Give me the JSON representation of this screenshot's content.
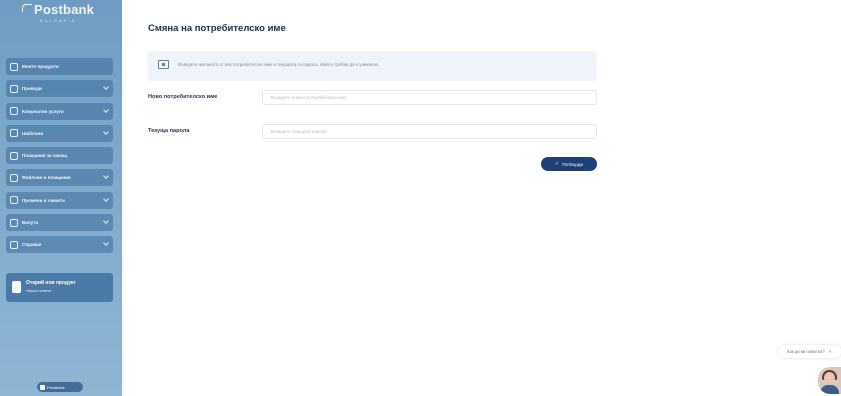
{
  "brand": {
    "name": "Postbank",
    "tagline": "BULGARIA"
  },
  "sidebar": {
    "items": [
      {
        "label": "Моите продукти",
        "icon": "wallet-icon",
        "has_chevron": false
      },
      {
        "label": "Преводи",
        "icon": "transfer-icon",
        "has_chevron": true
      },
      {
        "label": "Комунални услуги",
        "icon": "lightbulb-icon",
        "has_chevron": true
      },
      {
        "label": "Шаблони",
        "icon": "grid-icon",
        "has_chevron": true
      },
      {
        "label": "Плащания за чакащ",
        "icon": "clock-icon",
        "has_chevron": false
      },
      {
        "label": "Файлове и плащания",
        "icon": "file-icon",
        "has_chevron": true
      },
      {
        "label": "Промени и лимити",
        "icon": "sliders-icon",
        "has_chevron": true
      },
      {
        "label": "Валута",
        "icon": "currency-icon",
        "has_chevron": true
      },
      {
        "label": "Справки",
        "icon": "report-icon",
        "has_chevron": true
      }
    ],
    "promo": {
      "title": "Открий нов продукт",
      "subtitle": "Научи повече"
    },
    "bottom_button": "Feedback"
  },
  "main": {
    "title": "Смяна на потребителско име",
    "info_text": "Въведете желаното от вас потребителско име и текущата си парола. Името трябва да е уникално.",
    "fields": [
      {
        "label": "Ново потребителско име",
        "placeholder": "Въведете новото потребителско име"
      },
      {
        "label": "Текуща парола",
        "placeholder": "Въведете текущата парола"
      }
    ],
    "confirm_label": "Потвърди"
  },
  "widgets": {
    "help_label": "Как да ви помогна?",
    "close_symbol": "×"
  },
  "colors": {
    "sidebar": "#7ca7cb",
    "primary_button": "#1f3f78",
    "title": "#1a2f4d",
    "info_bg": "#eef4fa"
  }
}
